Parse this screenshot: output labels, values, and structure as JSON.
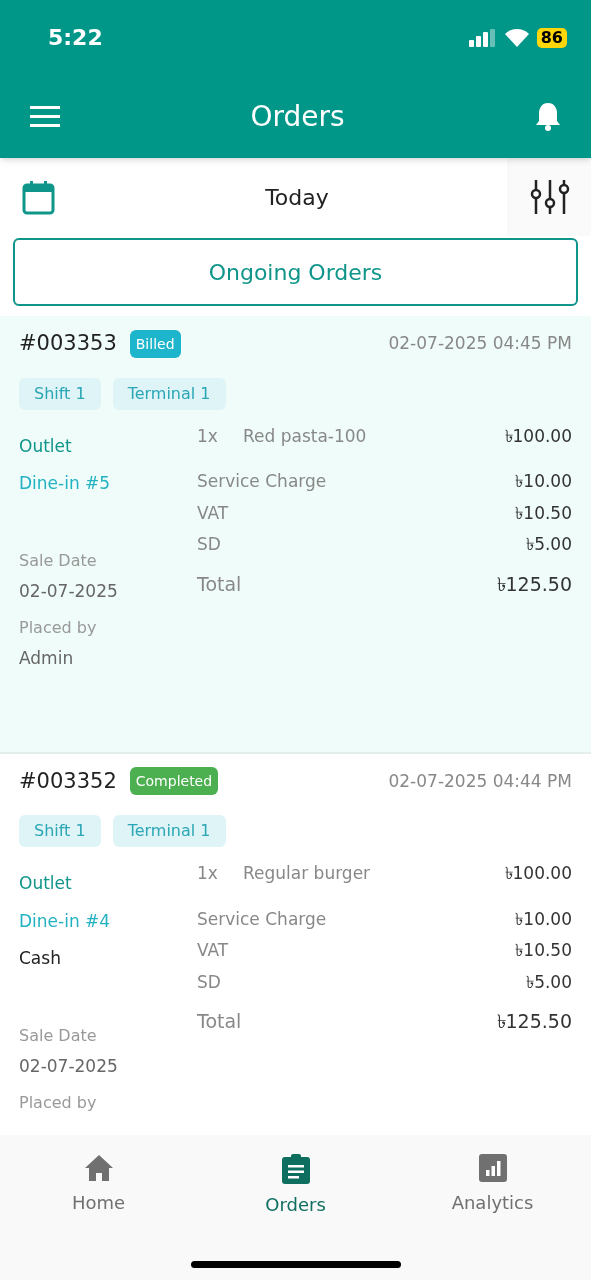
{
  "status_bar": {
    "time": "5:22",
    "battery": "86"
  },
  "app_bar": {
    "title": "Orders"
  },
  "date_filter": {
    "label": "Today"
  },
  "section_button": {
    "label": "Ongoing Orders"
  },
  "orders": [
    {
      "number": "#003353",
      "status": {
        "label": "Billed",
        "kind": "billed"
      },
      "datetime": "02-07-2025 04:45 PM",
      "selected": true,
      "tags": [
        "Shift 1",
        "Terminal 1"
      ],
      "outlet": "Outlet",
      "table": "Dine-in #5",
      "sale_date_label": "Sale Date",
      "sale_date": "02-07-2025",
      "placed_by_label": "Placed by",
      "placed_by": "Admin",
      "items": [
        {
          "qty": "1x",
          "name": "Red pasta-100",
          "price": "৳100.00"
        }
      ],
      "charges": [
        {
          "label": "Service Charge",
          "amount": "৳10.00"
        },
        {
          "label": "VAT",
          "amount": "৳10.50"
        },
        {
          "label": "SD",
          "amount": "৳5.00"
        }
      ],
      "total_label": "Total",
      "total": "৳125.50"
    },
    {
      "number": "#003352",
      "status": {
        "label": "Completed",
        "kind": "completed"
      },
      "datetime": "02-07-2025 04:44 PM",
      "selected": false,
      "tags": [
        "Shift 1",
        "Terminal 1"
      ],
      "outlet": "Outlet",
      "table": "Dine-in #4",
      "payment": "Cash",
      "sale_date_label": "Sale Date",
      "sale_date": "02-07-2025",
      "placed_by_label": "Placed by",
      "items": [
        {
          "qty": "1x",
          "name": "Regular burger",
          "price": "৳100.00"
        }
      ],
      "charges": [
        {
          "label": "Service Charge",
          "amount": "৳10.00"
        },
        {
          "label": "VAT",
          "amount": "৳10.50"
        },
        {
          "label": "SD",
          "amount": "৳5.00"
        }
      ],
      "total_label": "Total",
      "total": "৳125.50"
    }
  ],
  "bottom_nav": [
    {
      "label": "Home",
      "kind": "home",
      "selected": false
    },
    {
      "label": "Orders",
      "kind": "orders",
      "selected": true
    },
    {
      "label": "Analytics",
      "kind": "analytics",
      "selected": false
    }
  ]
}
